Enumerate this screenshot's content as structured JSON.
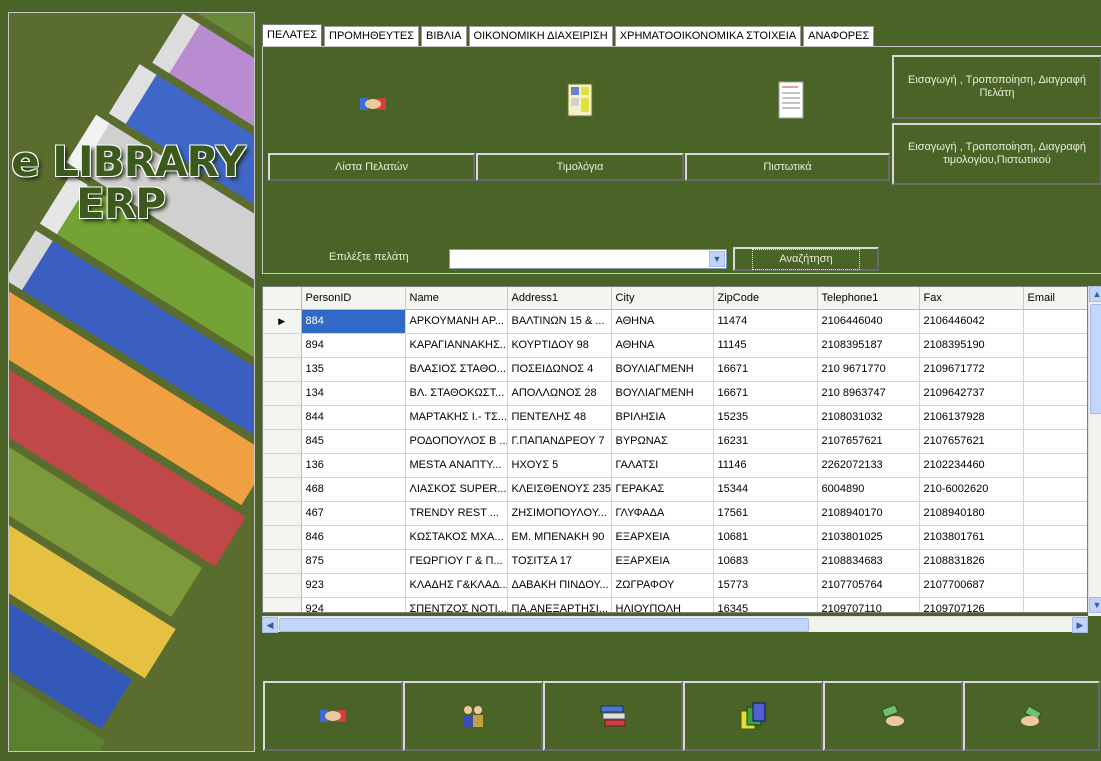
{
  "banner": {
    "title_line1": "e LIBRARY",
    "title_line2": "ERP"
  },
  "tabs": [
    {
      "label": "ΠΕΛΑΤΕΣ",
      "active": true
    },
    {
      "label": "ΠΡΟΜΗΘΕΥΤΕΣ",
      "active": false
    },
    {
      "label": "ΒΙΒΛΙΑ",
      "active": false
    },
    {
      "label": "ΟΙΚΟΝΟΜΙΚΗ ΔΙΑΧΕΙΡΙΣΗ",
      "active": false
    },
    {
      "label": "ΧΡΗΜΑΤΟΟΙΚΟΝΟΜΙΚΑ ΣΤΟΙΧΕΙΑ",
      "active": false
    },
    {
      "label": "ΑΝΑΦΟΡΕΣ",
      "active": false
    }
  ],
  "customers_page": {
    "btn_customer_list": "Λίστα Πελατών",
    "btn_invoices": "Τιμολόγια",
    "btn_credits": "Πιστωτικά",
    "btn_edit_customer": "Εισαγωγή , Τροποποίηση, Διαγραφή Πελάτη",
    "btn_edit_invoice": "Εισαγωγή , Τροποποίηση, Διαγραφή τιμολογίου,Πιστωτικού",
    "select_label": "Επιλέξτε πελάτη",
    "select_value": "",
    "search_label": "Αναζήτηση"
  },
  "grid": {
    "columns": [
      "PersonID",
      "Name",
      "Address1",
      "City",
      "ZipCode",
      "Telephone1",
      "Fax",
      "Email"
    ],
    "rows": [
      [
        "884",
        "ΑΡΚΟΥΜΑΝΗ ΑΡ...",
        "ΒΑΛΤΙΝΩΝ 15 & ...",
        "ΑΘΗΝΑ",
        "11474",
        "2106446040",
        "2106446042",
        ""
      ],
      [
        "894",
        "ΚΑΡΑΓΙΑΝΝΑΚΗΣ...",
        "ΚΟΥΡΤΙΔΟΥ 98",
        "ΑΘΗΝΑ",
        "11145",
        "2108395187",
        "2108395190",
        ""
      ],
      [
        "135",
        "ΒΛΑΣΙΟΣ ΣΤΑΘΟ...",
        "ΠΟΣΕΙΔΩΝΟΣ 4",
        "ΒΟΥΛΙΑΓΜΕΝΗ",
        "16671",
        "210 9671770",
        "2109671772",
        ""
      ],
      [
        "134",
        "ΒΛ. ΣΤΑΘΟΚΩΣΤ...",
        "ΑΠΟΛΛΩΝΟΣ 28",
        "ΒΟΥΛΙΑΓΜΕΝΗ",
        "16671",
        "210 8963747",
        "2109642737",
        ""
      ],
      [
        "844",
        "ΜΑΡΤΑΚΗΣ Ι.- ΤΣ...",
        "ΠΕΝΤΕΛΗΣ 48",
        "ΒΡΙΛΗΣΙΑ",
        "15235",
        "2108031032",
        "2106137928",
        ""
      ],
      [
        "845",
        "ΡΟΔΟΠΟΥΛΟΣ Β ...",
        "Γ.ΠΑΠΑΝΔΡΕΟΥ 7",
        "ΒΥΡΩΝΑΣ",
        "16231",
        "2107657621",
        "2107657621",
        ""
      ],
      [
        "136",
        "MESTA ΑΝΑΠΤΥ...",
        "ΗΧΟΥΣ 5",
        "ΓΑΛΑΤΣΙ",
        "11146",
        "2262072133",
        "2102234460",
        ""
      ],
      [
        "468",
        "ΛΙΑΣΚΟΣ SUPER...",
        "ΚΛΕΙΣΘΕΝΟΥΣ 235",
        "ΓΕΡΑΚΑΣ",
        "15344",
        "6004890",
        "210-6002620",
        ""
      ],
      [
        "467",
        "TRENDY REST ...",
        "ΖΗΣΙΜΟΠΟΥΛΟΥ...",
        "ΓΛΥΦΑΔΑ",
        "17561",
        "2108940170",
        "2108940180",
        ""
      ],
      [
        "846",
        "ΚΩΣΤΑΚΟΣ ΜΧΑ...",
        "ΕΜ. ΜΠΕΝΑΚΗ 90",
        "ΕΞΑΡΧΕΙΑ",
        "10681",
        "2103801025",
        "2103801761",
        ""
      ],
      [
        "875",
        "ΓΕΩΡΓΙΟΥ Γ & Π...",
        "ΤΟΣΙΤΣΑ 17",
        "ΕΞΑΡΧΕΙΑ",
        "10683",
        "2108834683",
        "2108831826",
        ""
      ],
      [
        "923",
        "ΚΛΑΔΗΣ Γ&ΚΛΑΔ...",
        "ΔΑΒΑΚΗ ΠΙΝΔΟΥ...",
        "ΖΩΓΡΑΦΟΥ",
        "15773",
        "2107705764",
        "2107700687",
        ""
      ],
      [
        "924",
        "ΣΠΕΝΤΖΟΣ ΝΟΤΙ...",
        "ΠΑ.ΑΝΕΞΑΡΤΗΣΙ...",
        "ΗΛΙΟΥΠΟΛΗ",
        "16345",
        "2109707110",
        "2109707126",
        ""
      ]
    ],
    "selected_row": 0
  },
  "toolbar_icons": [
    "handshake-icon",
    "people-icon",
    "invoice-stack-icon",
    "folders-icon",
    "money-hand-icon",
    "money-pay-icon"
  ],
  "colors": {
    "background": "#4a6428",
    "selection": "#3169c6",
    "button_text": "#e8ecd8"
  }
}
